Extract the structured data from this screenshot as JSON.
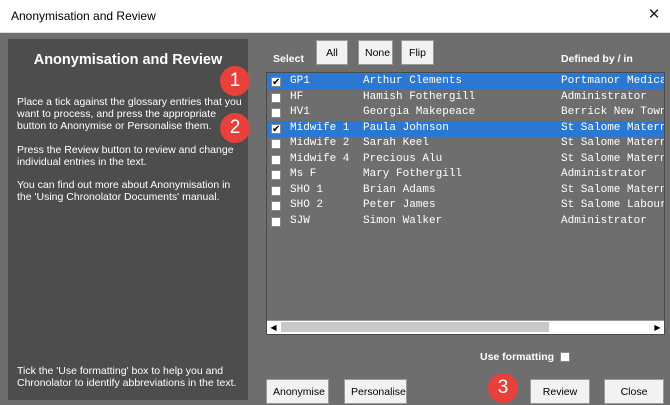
{
  "window": {
    "title": "Anonymisation and Review",
    "close_glyph": "✕"
  },
  "left_panel": {
    "heading": "Anonymisation and Review",
    "para1": "Place a tick against the glossary entries that you want to process, and press the appropriate button to Anonymise or Personalise them.",
    "para2": "Press the Review button to review and change individual entries in the text.",
    "para3": "You can find out more about Anonymisation in the 'Using Chronolator Documents' manual.",
    "footer": "Tick the 'Use formatting' box to help you and Chronolator to identify abbreviations in the text."
  },
  "select": {
    "label": "Select",
    "all": "All",
    "none": "None",
    "flip": "Flip"
  },
  "list": {
    "defined_by_header": "Defined by / in",
    "rows": [
      {
        "abbr": "GP1",
        "name": "Arthur Clements",
        "defined": "Portmanor Medical",
        "checked": true,
        "selected": true
      },
      {
        "abbr": "HF",
        "name": "Hamish Fothergill",
        "defined": "Administrator",
        "checked": false,
        "selected": false
      },
      {
        "abbr": "HV1",
        "name": "Georgia Makepeace",
        "defined": "Berrick New Town",
        "checked": false,
        "selected": false
      },
      {
        "abbr": "Midwife 1",
        "name": "Paula Johnson",
        "defined": "St Salome Maternity",
        "checked": true,
        "selected": true
      },
      {
        "abbr": "Midwife 2",
        "name": "Sarah Keel",
        "defined": "St Salome Maternity",
        "checked": false,
        "selected": false
      },
      {
        "abbr": "Midwife 4",
        "name": "Precious Alu",
        "defined": "St Salome Maternity",
        "checked": false,
        "selected": false
      },
      {
        "abbr": "Ms F",
        "name": "Mary Fothergill",
        "defined": "Administrator",
        "checked": false,
        "selected": false
      },
      {
        "abbr": "SHO 1",
        "name": "Brian Adams",
        "defined": "St Salome Maternity",
        "checked": false,
        "selected": false
      },
      {
        "abbr": "SHO 2",
        "name": "Peter James",
        "defined": "St Salome Labour",
        "checked": false,
        "selected": false
      },
      {
        "abbr": "SJW",
        "name": "Simon Walker",
        "defined": "Administrator",
        "checked": false,
        "selected": false
      }
    ]
  },
  "use_formatting": {
    "label": "Use formatting",
    "checked": false
  },
  "buttons": {
    "anonymise": "Anonymise",
    "personalise": "Personalise",
    "review": "Review",
    "close": "Close"
  },
  "badges": [
    "1",
    "2",
    "3"
  ],
  "colors": {
    "panel_dark": "#4d4d4d",
    "panel_mid": "#6e6e6e",
    "selection": "#2a78d4",
    "badge": "#e8413b"
  }
}
